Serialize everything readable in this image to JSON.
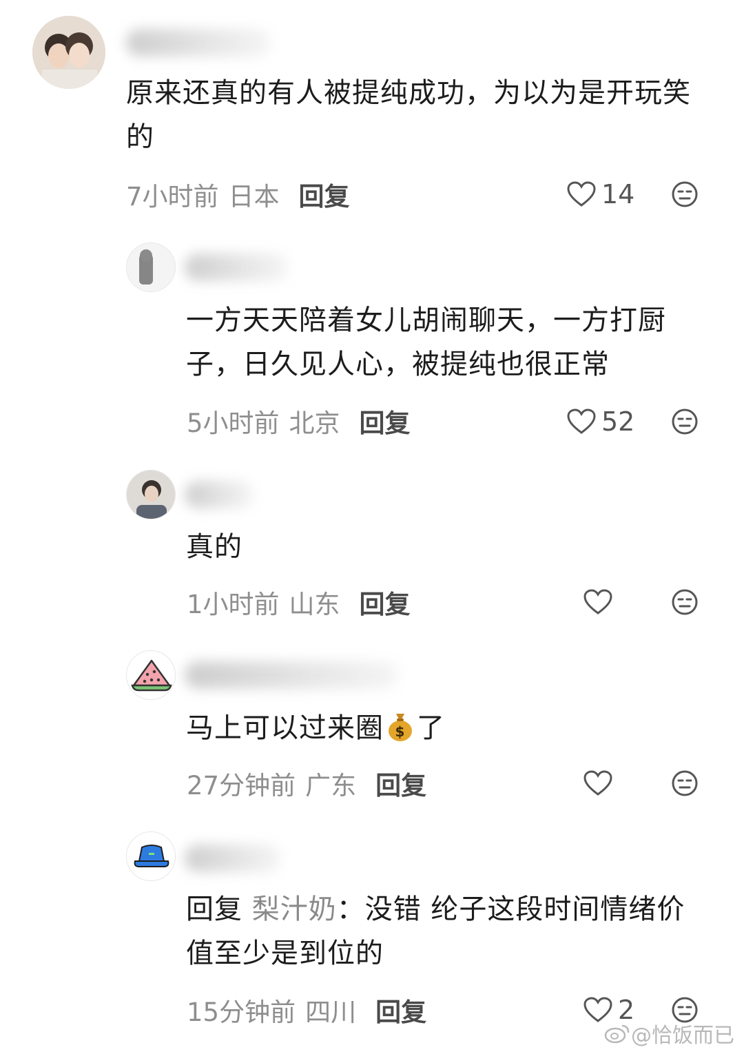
{
  "comments": [
    {
      "text": "原来还真的有人被提纯成功，为以为是开玩笑的",
      "time": "7小时前",
      "location": "日本",
      "reply_label": "回复",
      "likes": "14"
    },
    {
      "text": "一方天天陪着女儿胡闹聊天，一方打厨子，日久见人心，被提纯也很正常",
      "time": "5小时前",
      "location": "北京",
      "reply_label": "回复",
      "likes": "52"
    },
    {
      "text": "真的",
      "time": "1小时前",
      "location": "山东",
      "reply_label": "回复",
      "likes": ""
    },
    {
      "text_before": "马上可以过来圈",
      "text_after": "了",
      "emoji": "money-bag-icon",
      "time": "27分钟前",
      "location": "广东",
      "reply_label": "回复",
      "likes": ""
    },
    {
      "reply_prefix": "回复",
      "reply_to": "梨汁奶",
      "text": "：没错 纶子这段时间情绪价值至少是到位的",
      "time": "15分钟前",
      "location": "四川",
      "reply_label": "回复",
      "likes": "2"
    }
  ],
  "watermark": "@恰饭而已",
  "colors": {
    "text": "#1c1c1c",
    "meta": "#8e8e8e",
    "reply_name": "#8a8a8a",
    "icon_stroke": "#555555"
  }
}
